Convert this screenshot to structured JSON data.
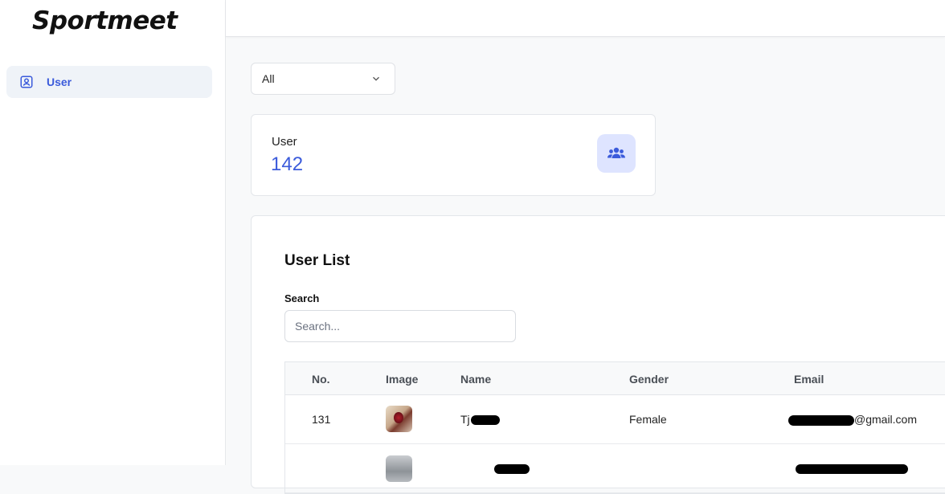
{
  "app": {
    "logo_text": "Sportmeet"
  },
  "sidebar": {
    "items": [
      {
        "label": "User",
        "icon": "user-square-icon",
        "active": true
      }
    ]
  },
  "filter": {
    "selected": "All",
    "icon": "chevron-down-icon"
  },
  "stat_card": {
    "label": "User",
    "value": "142",
    "icon": "users-group-icon"
  },
  "user_list": {
    "title": "User List",
    "search_label": "Search",
    "search_placeholder": "Search...",
    "columns": [
      "No.",
      "Image",
      "Name",
      "Gender",
      "Email"
    ],
    "rows": [
      {
        "no": "131",
        "name_visible": "Tj",
        "gender": "Female",
        "email_visible": "@gmail.com"
      }
    ]
  },
  "colors": {
    "accent": "#3b5bdb",
    "active_nav_bg": "#eff3f8",
    "stat_icon_bg": "#dee4ff",
    "page_bg": "#f8f9fa"
  }
}
